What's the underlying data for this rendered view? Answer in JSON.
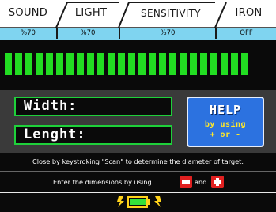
{
  "tabs": [
    {
      "label": "SOUND",
      "value": "%70"
    },
    {
      "label": "LIGHT",
      "value": "%70"
    },
    {
      "label": "SENSITIVITY",
      "value": "%70"
    },
    {
      "label": "IRON",
      "value": "OFF"
    }
  ],
  "meter": {
    "level": 1.0,
    "segments": 24,
    "color": "#22dd22"
  },
  "dimensions": {
    "width_label": "Width:",
    "length_label": "Lenght:"
  },
  "help": {
    "title": "HELP",
    "line1": "by using",
    "line2": "+ or -"
  },
  "info": {
    "close_text": "Close by keystroking \"Scan\" to determine the diameter of target.",
    "enter_text": "Enter the dimensions by using",
    "and_text": "and"
  },
  "battery": {
    "level": 1.0,
    "color": "#36e03a"
  },
  "colors": {
    "tab_value_bg": "#7fd4f0",
    "field_border": "#1ed03a",
    "help_bg": "#2c72e0",
    "help_text": "#ffe82a",
    "minus_button": "#e02020",
    "plus_button": "#e02020",
    "battery_frame": "#ffd21a"
  },
  "icons": {
    "minus": "minus-icon",
    "plus": "plus-icon",
    "battery": "battery-icon",
    "bolt": "lightning-bolt-icon"
  }
}
